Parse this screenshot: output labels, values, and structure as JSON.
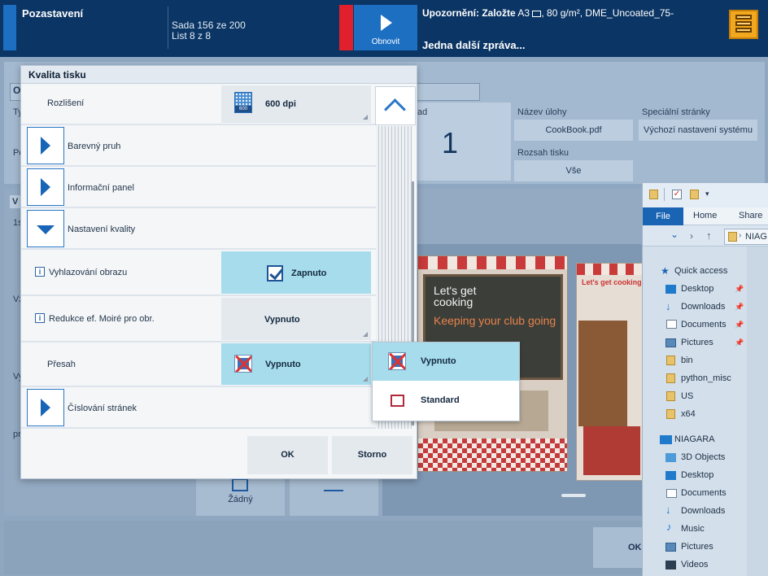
{
  "topbar": {
    "status": "Pozastavení",
    "job_line1": "Sada 156 ze 200",
    "job_line2": "List 8 z 8",
    "refresh_label": "Obnovit",
    "warning_prefix": "Upozornění: Založte",
    "warning_media": " A3 ",
    "warning_rest": ", 80 g/m², DME_Uncoated_75-",
    "message": "Jedna další zpráva..."
  },
  "background": {
    "copies_label": "ad",
    "copies_value": "1",
    "job_name_label": "Název úlohy",
    "job_name_value": "CookBook.pdf",
    "special_pages_label": "Speciální stránky",
    "special_pages_value": "Výchozí nastavení systému",
    "range_label": "Rozsah tisku",
    "range_value": "Vše",
    "tab_letter": "O",
    "lbl_ty": "Ty",
    "lbl_po": "Po",
    "lbl_v": "V",
    "lbl_1s": "1s",
    "lbl_vz": "Vz",
    "lbl_vy": "Vy",
    "lbl_pr": "pr",
    "none_button": "Žádný",
    "ok_button": "OK",
    "page1_line1": "Let's get",
    "page1_line2": "cooking",
    "page1_line3": "Keeping your club going",
    "page2_title": "Let's get cooking"
  },
  "explorer": {
    "tab_file": "File",
    "tab_home": "Home",
    "tab_share": "Share",
    "path": "NIAG",
    "quick_access": "Quick access",
    "items": [
      {
        "label": "Desktop"
      },
      {
        "label": "Downloads"
      },
      {
        "label": "Documents"
      },
      {
        "label": "Pictures"
      },
      {
        "label": "bin"
      },
      {
        "label": "python_misc"
      },
      {
        "label": "US"
      },
      {
        "label": "x64"
      }
    ],
    "computer": "NIAGARA",
    "computer_items": [
      {
        "label": "3D Objects"
      },
      {
        "label": "Desktop"
      },
      {
        "label": "Documents"
      },
      {
        "label": "Downloads"
      },
      {
        "label": "Music"
      },
      {
        "label": "Pictures"
      },
      {
        "label": "Videos"
      }
    ]
  },
  "dialog": {
    "title": "Kvalita tisku",
    "resolution_label": "Rozlišení",
    "resolution_value": "600 dpi",
    "resolution_icon_text": "600",
    "color_bar_label": "Barevný pruh",
    "info_panel_label": "Informační panel",
    "quality_settings_label": "Nastavení kvality",
    "smoothing_label": "Vyhlazování obrazu",
    "smoothing_value": "Zapnuto",
    "moire_label": "Redukce ef. Moiré pro obr.",
    "moire_value": "Vypnuto",
    "trapping_label": "Přesah",
    "trapping_value": "Vypnuto",
    "page_numbering_label": "Číslování stránek",
    "ok_label": "OK",
    "cancel_label": "Storno",
    "info_glyph": "i"
  },
  "dropdown": {
    "options": [
      {
        "label": "Vypnuto",
        "selected": true
      },
      {
        "label": "Standard",
        "selected": false
      }
    ]
  },
  "colors": {
    "accent": "#1d6fc2",
    "selected": "#a6dcec",
    "alert": "#e0202c",
    "menu": "#f2a81e"
  }
}
